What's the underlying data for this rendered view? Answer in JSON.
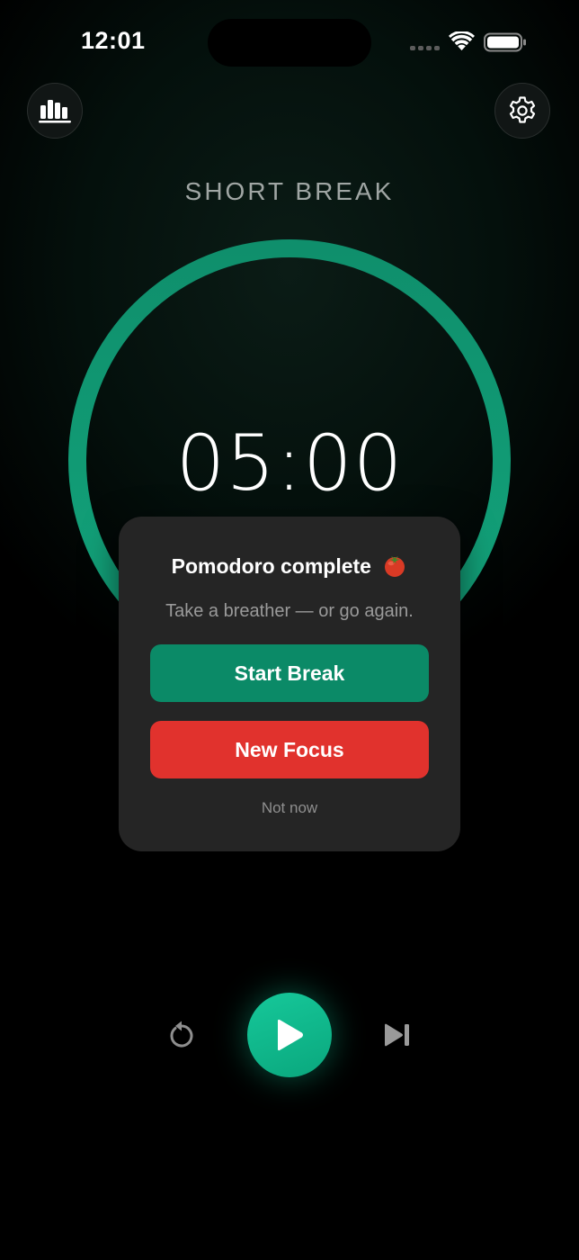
{
  "status_bar": {
    "time": "12:01"
  },
  "header": {
    "stats_icon": "bar-chart-icon",
    "settings_icon": "gear-icon"
  },
  "timer": {
    "mode_label": "SHORT BREAK",
    "time_display": "05:00",
    "progress_fraction": 1.0,
    "ring_color": "#0f8f6c"
  },
  "dialog": {
    "title": "Pomodoro complete",
    "title_icon": "tomato-emoji",
    "subtitle": "Take a breather — or go again.",
    "primary_button_label": "Start Break",
    "primary_button_color": "#0b8a67",
    "secondary_button_label": "New Focus",
    "secondary_button_color": "#e1322d",
    "dismiss_label": "Not now"
  },
  "controls": {
    "reset_icon": "reset-icon",
    "play_icon": "play-icon",
    "skip_icon": "skip-forward-icon",
    "accent_color": "#12b98c"
  }
}
